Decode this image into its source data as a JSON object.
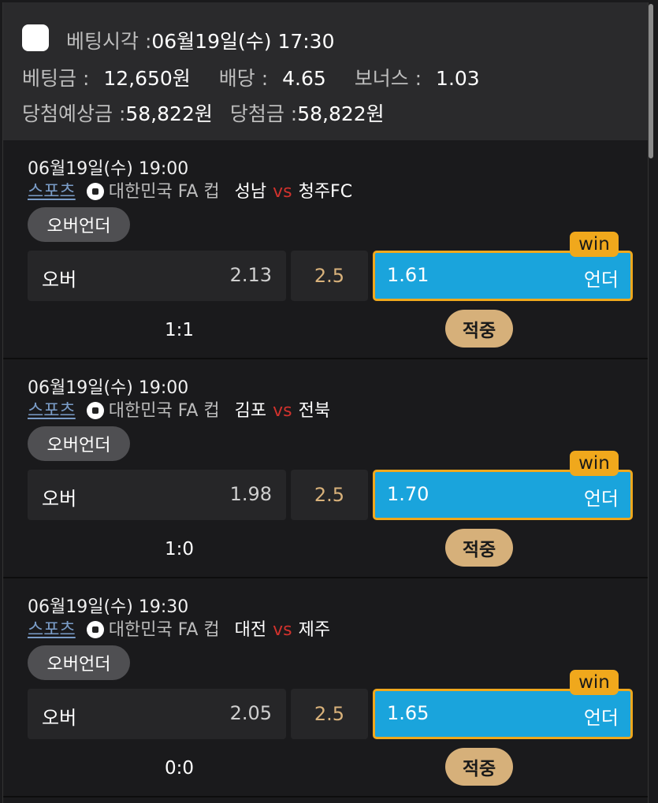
{
  "header": {
    "bet_time_label": "베팅시각 :",
    "bet_time_value": "06월19일(수) 17:30",
    "bet_amount_label": "베팅금 :",
    "bet_amount_value": "12,650원",
    "odds_label": "배당 :",
    "odds_value": "4.65",
    "bonus_label": "보너스 :",
    "bonus_value": "1.03",
    "expected_label": "당첨예상금 :",
    "expected_value": "58,822원",
    "winnings_label": "당첨금 :",
    "winnings_value": "58,822원"
  },
  "colors": {
    "under_box": "#1aa4dc",
    "win_badge": "#f0a81c",
    "hit_pill": "#d6b07a",
    "line_value": "#d9b27b",
    "vs": "#d2322d"
  },
  "matches": [
    {
      "time": "06월19일(수) 19:00",
      "sport": "스포츠",
      "sport_icon": "soccer-ball-icon",
      "league": "대한민국 FA 컵",
      "home": "성남",
      "vs": "vs",
      "away": "청주FC",
      "bet_type": "오버언더",
      "over_label": "오버",
      "over_odds": "2.13",
      "line": "2.5",
      "under_odds": "1.61",
      "under_label": "언더",
      "win_badge": "win",
      "score": "1:1",
      "result": "적중"
    },
    {
      "time": "06월19일(수) 19:00",
      "sport": "스포츠",
      "sport_icon": "soccer-ball-icon",
      "league": "대한민국 FA 컵",
      "home": "김포",
      "vs": "vs",
      "away": "전북",
      "bet_type": "오버언더",
      "over_label": "오버",
      "over_odds": "1.98",
      "line": "2.5",
      "under_odds": "1.70",
      "under_label": "언더",
      "win_badge": "win",
      "score": "1:0",
      "result": "적중"
    },
    {
      "time": "06월19일(수) 19:30",
      "sport": "스포츠",
      "sport_icon": "soccer-ball-icon",
      "league": "대한민국 FA 컵",
      "home": "대전",
      "vs": "vs",
      "away": "제주",
      "bet_type": "오버언더",
      "over_label": "오버",
      "over_odds": "2.05",
      "line": "2.5",
      "under_odds": "1.65",
      "under_label": "언더",
      "win_badge": "win",
      "score": "0:0",
      "result": "적중"
    }
  ]
}
